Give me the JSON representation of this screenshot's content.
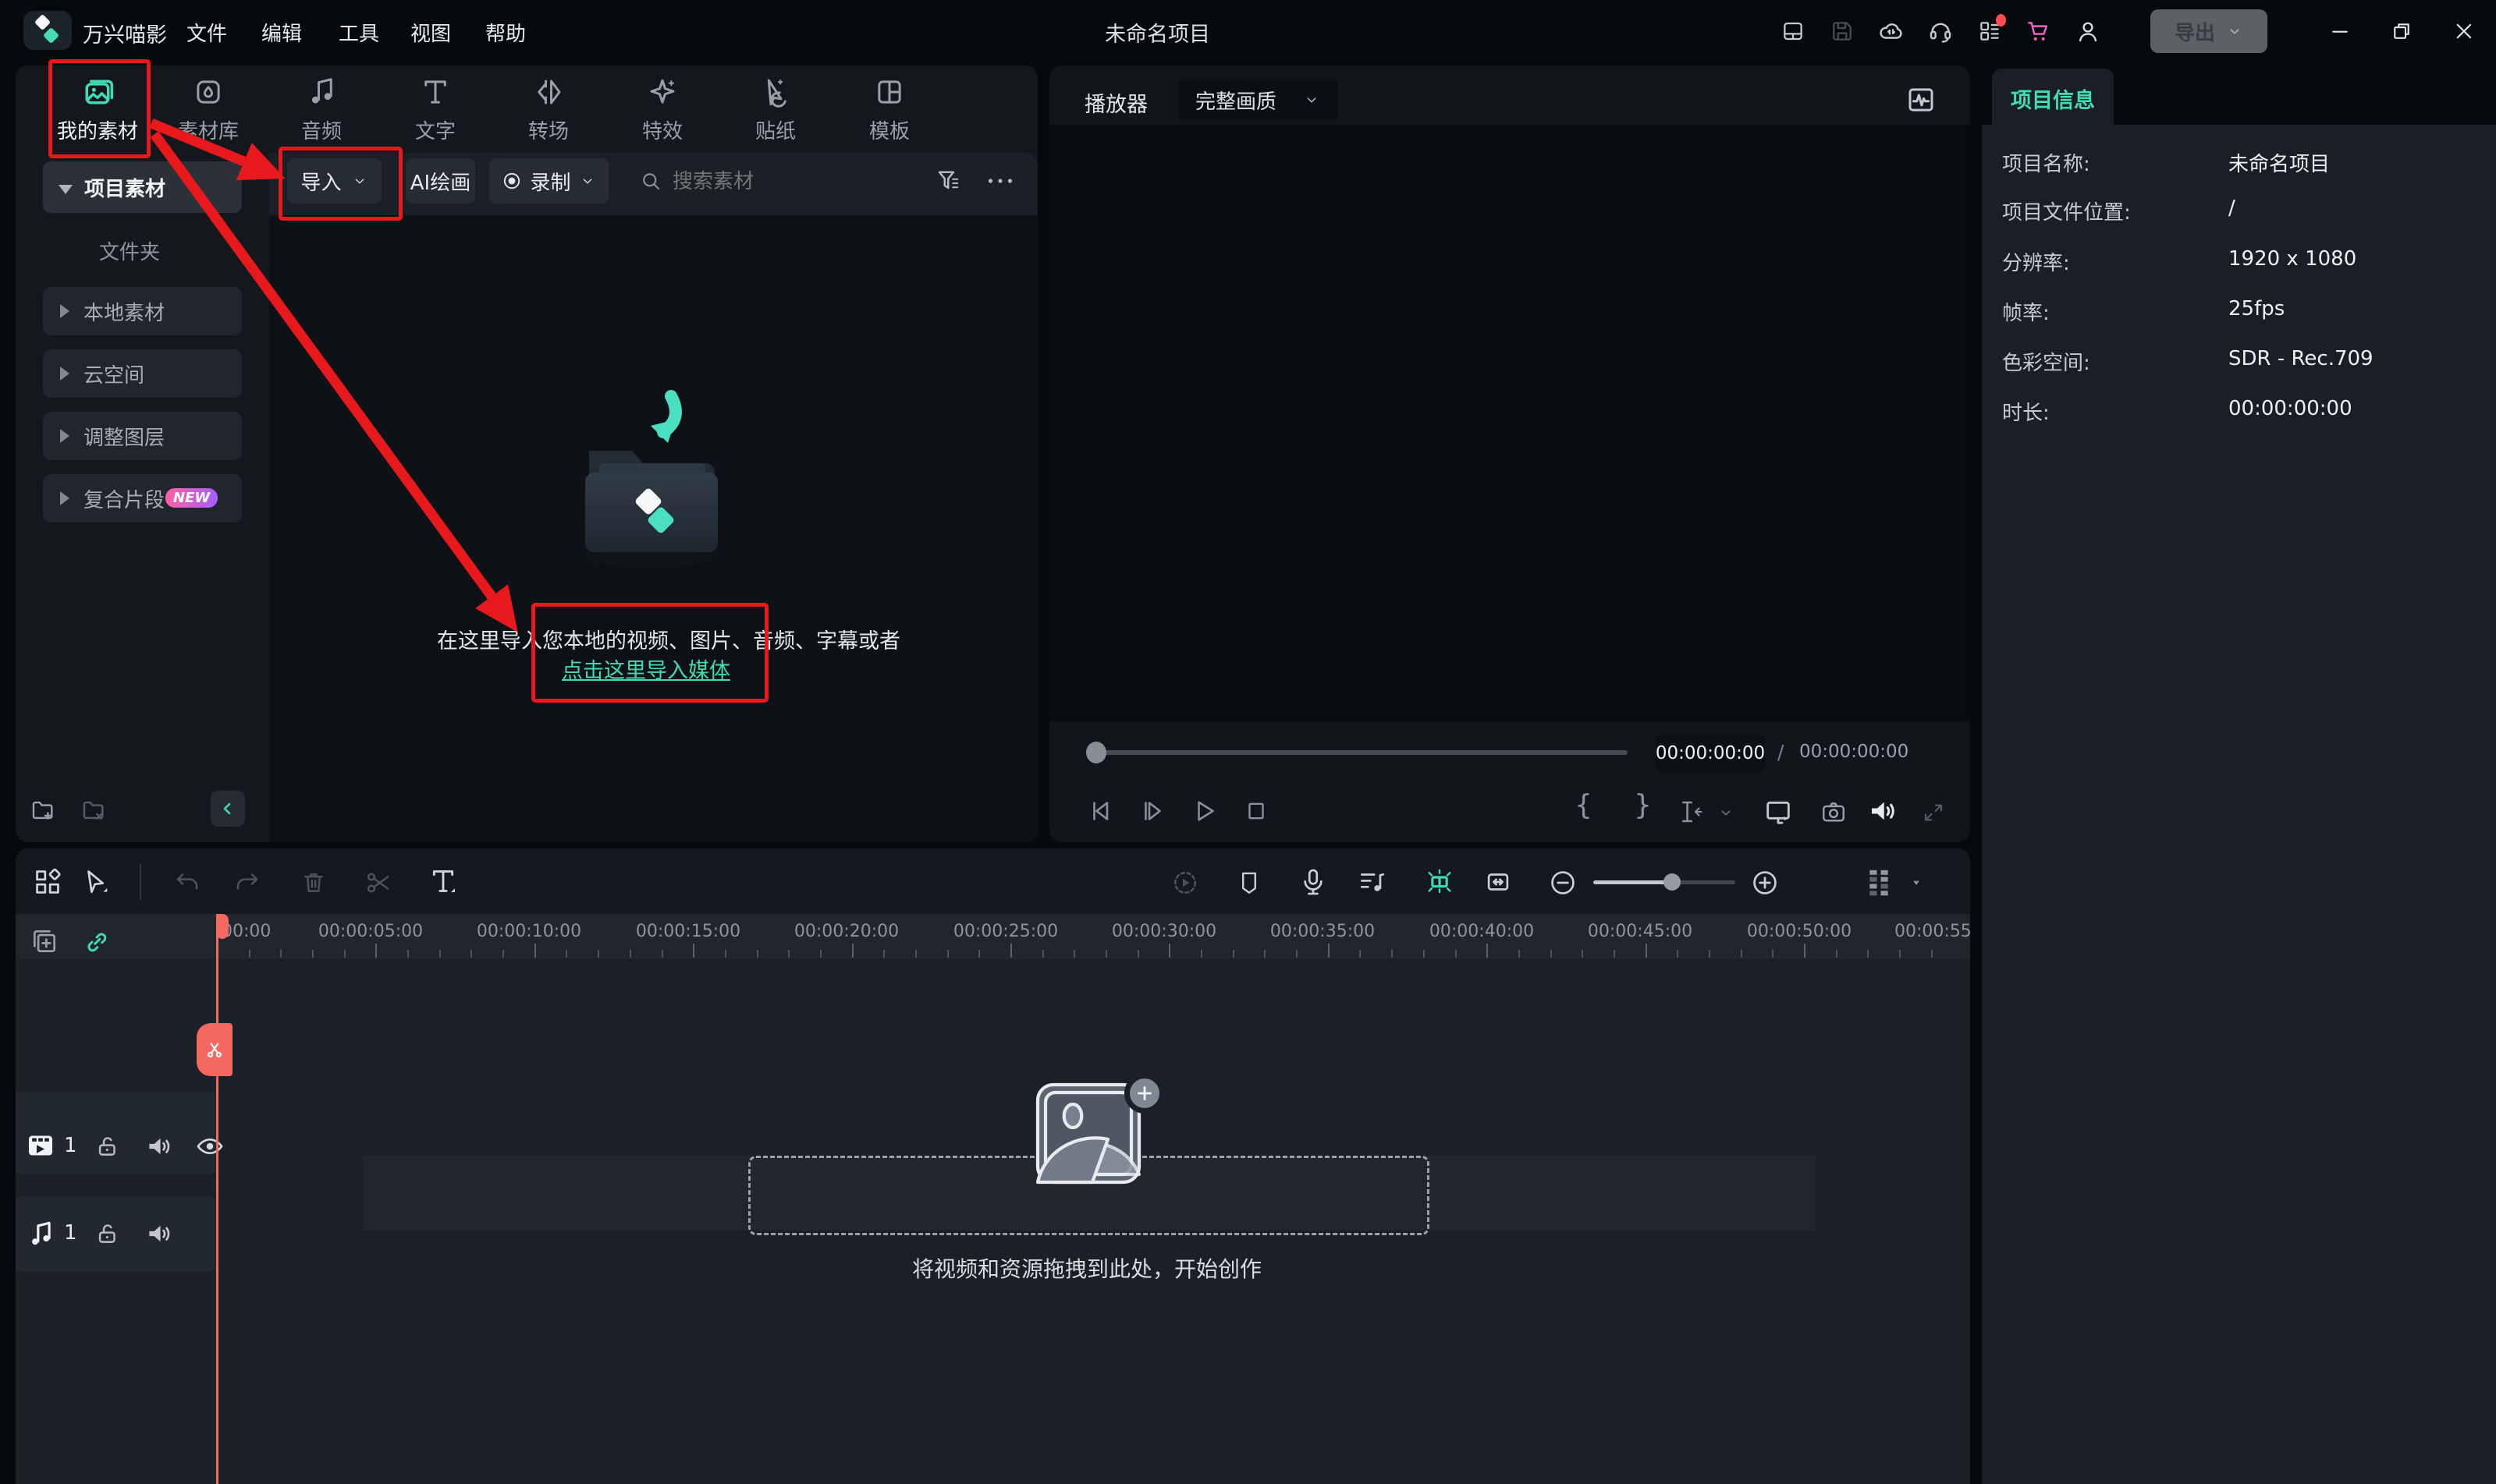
{
  "colors": {
    "accent": "#3fdcb2",
    "annotation_red": "#e8191c",
    "playhead": "#f4685f",
    "new_badge_gradient": [
      "#ff5fa2",
      "#a55eff"
    ],
    "notification_dot": "#ff4d4f",
    "cart_pink": "#f062c8"
  },
  "titlebar": {
    "app_name": "万兴喵影",
    "menus": [
      "文件",
      "编辑",
      "工具",
      "视图",
      "帮助"
    ],
    "project_title": "未命名项目",
    "export_label": "导出",
    "icons": [
      "layout-icon",
      "save-icon",
      "cloud-sync-icon",
      "headset-support-icon",
      "apps-grid-icon",
      "cart-icon",
      "account-icon"
    ],
    "window_controls": [
      "minimize",
      "restore",
      "close"
    ]
  },
  "media_panel": {
    "tabs": [
      {
        "label": "我的素材",
        "icon": "my-media-icon",
        "active": true
      },
      {
        "label": "素材库",
        "icon": "stock-media-icon"
      },
      {
        "label": "音频",
        "icon": "audio-icon"
      },
      {
        "label": "文字",
        "icon": "text-icon"
      },
      {
        "label": "转场",
        "icon": "transition-icon"
      },
      {
        "label": "特效",
        "icon": "effects-icon"
      },
      {
        "label": "贴纸",
        "icon": "sticker-icon"
      },
      {
        "label": "模板",
        "icon": "template-icon"
      }
    ],
    "toolbar": {
      "import_label": "导入",
      "ai_paint_label": "AI绘画",
      "record_label": "录制",
      "search_placeholder": "搜索素材"
    },
    "sidebar": {
      "project_item": "项目素材",
      "folder_item": "文件夹",
      "groups": [
        "本地素材",
        "云空间",
        "调整图层",
        "复合片段"
      ],
      "new_badge": "NEW"
    },
    "empty_state": {
      "line1": "在这里导入您本地的视频、图片、音频、字幕或者",
      "link": "点击这里导入媒体"
    }
  },
  "player": {
    "label": "播放器",
    "quality": "完整画质",
    "current_time": "00:00:00:00",
    "separator": "/",
    "total_time": "00:00:00:00"
  },
  "project_info": {
    "tab": "项目信息",
    "rows": [
      {
        "label": "项目名称:",
        "value": "未命名项目"
      },
      {
        "label": "项目文件位置:",
        "value": "/"
      },
      {
        "label": "分辨率:",
        "value": "1920 x 1080"
      },
      {
        "label": "帧率:",
        "value": "25fps"
      },
      {
        "label": "色彩空间:",
        "value": "SDR - Rec.709"
      },
      {
        "label": "时长:",
        "value": "00:00:00:00"
      }
    ]
  },
  "timeline": {
    "ruler_labels": [
      "00:00",
      "00:00:05:00",
      "00:00:10:00",
      "00:00:15:00",
      "00:00:20:00",
      "00:00:25:00",
      "00:00:30:00",
      "00:00:35:00",
      "00:00:40:00",
      "00:00:45:00",
      "00:00:50:00",
      "00:00:55"
    ],
    "tracks": {
      "video": {
        "count": "1",
        "icons": [
          "video-track-icon",
          "lock-open-icon",
          "speaker-icon",
          "eye-icon"
        ]
      },
      "audio": {
        "count": "1",
        "icons": [
          "music-track-icon",
          "lock-open-icon",
          "speaker-icon"
        ]
      }
    },
    "empty_hint": "将视频和资源拖拽到此处，开始创作",
    "toolbar_icons": [
      "blocks-icon",
      "cursor-icon",
      "undo-icon",
      "redo-icon",
      "trash-icon",
      "scissors-icon",
      "text-tool-icon",
      "render-preview-icon",
      "marker-icon",
      "mic-icon",
      "audio-mixer-icon",
      "snap-icon",
      "ripple-icon",
      "zoom-out-icon",
      "zoom-in-icon",
      "track-manager-icon"
    ]
  }
}
